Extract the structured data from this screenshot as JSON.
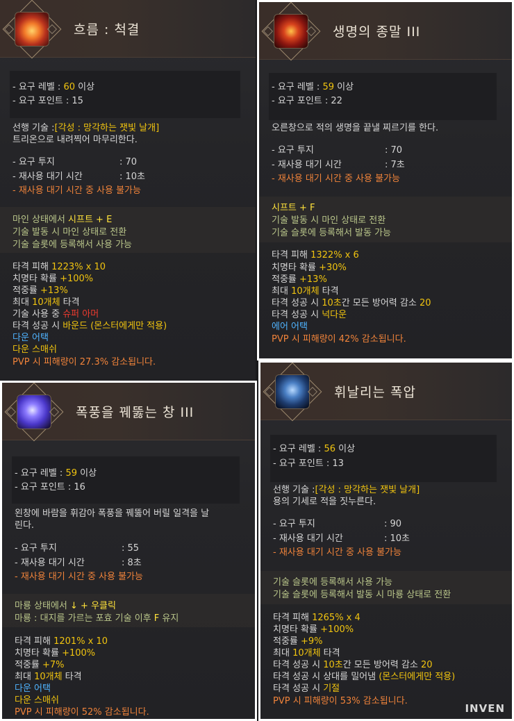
{
  "panels": {
    "p1": {
      "title": "흐름 : 척결",
      "req_level_label": "- 요구 레벨 : ",
      "req_level_value": "60",
      "req_level_suffix": " 이상",
      "req_point": "- 요구 포인트 : 15",
      "prereq_label": "선행 기술 :",
      "prereq_value": "[각성 : 망각하는 잿빛 날개]",
      "desc": "트리온으로 내려찍어 마무리한다.",
      "stat1_label": "- 요구 투지",
      "stat1_value": ": 70",
      "stat2_label": "- 재사용 대기 시간",
      "stat2_value": ": 10초",
      "cooldown_warn": "- 재사용 대기 시간 중 사용 불가능",
      "mode_prefix": "마인 상태에서 ",
      "mode_key": "시프트 + E",
      "mode_line2": "기술 발동 시 마인 상태로 전환",
      "mode_line3": "기술 슬롯에 등록해서 사용 가능",
      "dmg_label": "타격 피해 ",
      "dmg_value": "1223% x 10",
      "crit_label": "치명타 확률 ",
      "crit_value": "+100%",
      "acc_label": "적중률 ",
      "acc_value": "+13%",
      "max_prefix": "최대 ",
      "max_value": "10개체",
      "max_suffix": " 타격",
      "use_prefix": "기술 사용 중 ",
      "use_value": "슈퍼 아머",
      "hit_prefix": "타격 성공 시 ",
      "hit_value": "바운드 (몬스터에게만 적용)",
      "down_attack": "다운 어택",
      "down_smash": "다운 스매쉬",
      "pvp": "PVP 시 피해량이 27.3% 감소됩니다."
    },
    "p2": {
      "title": "생명의 종말 III",
      "req_level_label": "- 요구 레벨 : ",
      "req_level_value": "59",
      "req_level_suffix": " 이상",
      "req_point": "- 요구 포인트 : 22",
      "desc": "오른창으로 적의 생명을 끝낼 찌르기를 한다.",
      "stat1_label": "- 요구 투지",
      "stat1_value": ": 70",
      "stat2_label": "- 재사용 대기 시간",
      "stat2_value": ": 7초",
      "cooldown_warn": "- 재사용 대기 시간 중 사용 불가능",
      "mode_key": "시프트 + F",
      "mode_line2": "기술 발동 시 마인 상태로 전환",
      "mode_line3": "기술 슬롯에 등록해서 발동 가능",
      "dmg_label": "타격 피해 ",
      "dmg_value": "1322% x 6",
      "crit_label": "치명타 확률 ",
      "crit_value": "+30%",
      "acc_label": "적중률 ",
      "acc_value": "+13%",
      "max_prefix": "최대 ",
      "max_value": "10개체",
      "max_suffix": " 타격",
      "hit1_prefix": "타격 성공 시 ",
      "hit1_value": "10초",
      "hit1_mid": "간 모든 방어력 감소 ",
      "hit1_num": "20",
      "hit2_prefix": "타격 성공 시 ",
      "hit2_value": "넉다운",
      "air_attack": "에어 어택",
      "pvp": "PVP 시 피해량이 42% 감소됩니다."
    },
    "p3": {
      "title": "폭풍을 꿰뚫는 창 III",
      "req_level_label": "- 요구 레벨 : ",
      "req_level_value": "59",
      "req_level_suffix": " 이상",
      "req_point": "- 요구 포인트 : 16",
      "desc1": "왼창에 바람을 휘감아 폭풍을 꿰뚫어 버릴 일격을 날",
      "desc2": "린다.",
      "stat1_label": "- 요구 투지",
      "stat1_value": ": 55",
      "stat2_label": "- 재사용 대기 시간",
      "stat2_value": ": 8초",
      "cooldown_warn": "- 재사용 대기 시간 중 사용 불가능",
      "mode_prefix": "마룡 상태에서 ",
      "mode_key": "↓ + 우클릭",
      "mode_line2_prefix": "마룡 : 대지를 가르는 포효 기술 이후 ",
      "mode_line2_key": "F",
      "mode_line2_suffix": " 유지",
      "dmg_label": "타격 피해 ",
      "dmg_value": "1201% x 10",
      "crit_label": "치명타 확률 ",
      "crit_value": "+100%",
      "acc_label": "적중률 ",
      "acc_value": "+7%",
      "max_prefix": "최대 ",
      "max_value": "10개체",
      "max_suffix": " 타격",
      "down_attack": "다운 어택",
      "down_smash": "다운 스매쉬",
      "pvp": "PVP 시 피해량이 52% 감소됩니다."
    },
    "p4": {
      "title": "휘날리는 폭압",
      "req_level_label": "- 요구 레벨 : ",
      "req_level_value": "56",
      "req_level_suffix": " 이상",
      "req_point": "- 요구 포인트 : 13",
      "prereq_label": "선행 기술 :",
      "prereq_value": "[각성 : 망각하는 잿빛 날개]",
      "desc": "용의 기세로 적을 짓누른다.",
      "stat1_label": "- 요구 투지",
      "stat1_value": ": 90",
      "stat2_label": "- 재사용 대기 시간",
      "stat2_value": ": 10초",
      "cooldown_warn": "- 재사용 대기 시간 중 사용 불가능",
      "mode_line1": "기술 슬롯에 등록해서 사용 가능",
      "mode_line2": "기술 슬롯에 등록해서 발동 시 마룡 상태로 전환",
      "dmg_label": "타격 피해 ",
      "dmg_value": "1265% x 4",
      "crit_label": "치명타 확률 ",
      "crit_value": "+100%",
      "acc_label": "적중률 ",
      "acc_value": "+9%",
      "max_prefix": "최대 ",
      "max_value": "10개체",
      "max_suffix": " 타격",
      "hit1_prefix": "타격 성공 시 ",
      "hit1_value": "10초",
      "hit1_mid": "간 모든 방어력 감소 ",
      "hit1_num": "20",
      "hit2_prefix": "타격 성공 시 상대를 밀어냄 ",
      "hit2_value": "(몬스터에게만 적용)",
      "hit3_prefix": "타격 성공 시 ",
      "hit3_value": "기절",
      "pvp": "PVP 시 피해량이 53% 감소됩니다."
    }
  },
  "watermark": "INVEN",
  "colors": {
    "highlight_yellow": "#f1c40f",
    "warning_orange": "#f0833a",
    "red_text": "#ee3b2f",
    "blue_text": "#4fb3ff",
    "mode_green": "#b9c58a"
  },
  "icons": {
    "p1": "flame-burst-icon",
    "p2": "crimson-mask-icon",
    "p3": "storm-spear-icon",
    "p4": "dragon-armor-icon"
  }
}
